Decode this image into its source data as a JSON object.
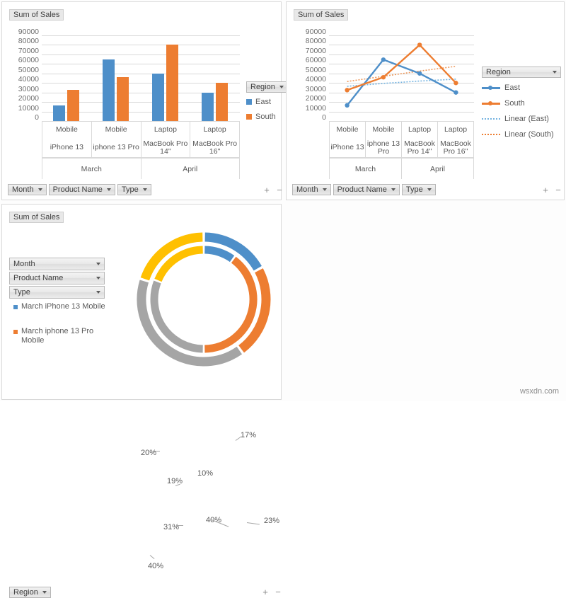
{
  "watermark": "wsxdn.com",
  "colors": {
    "east": "#4e8fc9",
    "south": "#ed7d31",
    "gray": "#a5a5a5",
    "yellow": "#ffc000",
    "gridline": "#d9d9d9"
  },
  "panels": {
    "bar": {
      "title": "Sum of Sales",
      "legend_header": "Region",
      "field_buttons": [
        "Month",
        "Product Name",
        "Type"
      ],
      "expand_label": "+",
      "collapse_label": "−"
    },
    "line": {
      "title": "Sum of Sales",
      "legend_header": "Region",
      "field_buttons": [
        "Month",
        "Product Name",
        "Type"
      ],
      "expand_label": "+",
      "collapse_label": "−"
    },
    "pie": {
      "title": "Sum of Sales",
      "slicers": [
        "Month",
        "Product Name",
        "Type"
      ],
      "legend": [
        "March iPhone 13 Mobile",
        "March iphone 13 Pro Mobile"
      ],
      "field_button": "Region",
      "expand_label": "+",
      "collapse_label": "−"
    }
  },
  "chart_data": [
    {
      "type": "bar",
      "title": "Sum of Sales",
      "categories": [
        "Mobile",
        "Mobile",
        "Laptop",
        "Laptop"
      ],
      "category_level2": [
        "iPhone 13",
        "iphone 13 Pro",
        "MacBook Pro 14\"",
        "MacBook Pro 16\""
      ],
      "category_level3": [
        "March",
        "April"
      ],
      "series": [
        {
          "name": "East",
          "values": [
            16500,
            64500,
            50000,
            30000
          ]
        },
        {
          "name": "South",
          "values": [
            32500,
            46000,
            80000,
            40000
          ]
        }
      ],
      "ylabel": "",
      "xlabel": "",
      "ylim": [
        0,
        90000
      ],
      "yticks": [
        90000,
        80000,
        70000,
        60000,
        50000,
        40000,
        30000,
        20000,
        10000,
        0
      ],
      "grid": true,
      "legend_position": "right",
      "legend_entries": [
        "East",
        "South"
      ]
    },
    {
      "type": "line",
      "title": "Sum of Sales",
      "categories": [
        "Mobile",
        "Mobile",
        "Laptop",
        "Laptop"
      ],
      "category_level2": [
        "iPhone 13",
        "iphone 13 Pro",
        "MacBook Pro 14\"",
        "MacBook Pro 16\""
      ],
      "category_level3": [
        "March",
        "April"
      ],
      "series": [
        {
          "name": "East",
          "values": [
            16500,
            64500,
            50000,
            30000
          ]
        },
        {
          "name": "South",
          "values": [
            32500,
            46000,
            80000,
            40000
          ]
        },
        {
          "name": "Linear (East)",
          "values": [
            36500,
            39500,
            42000,
            44000
          ]
        },
        {
          "name": "Linear (South)",
          "values": [
            41500,
            47000,
            52500,
            57500
          ]
        }
      ],
      "ylim": [
        0,
        90000
      ],
      "yticks": [
        90000,
        80000,
        70000,
        60000,
        50000,
        40000,
        30000,
        20000,
        10000,
        0
      ],
      "grid": true,
      "legend_position": "right",
      "legend_entries": [
        "East",
        "South",
        "Linear (East)",
        "Linear (South)"
      ]
    },
    {
      "type": "pie",
      "title": "Sum of Sales",
      "variant": "doughnut",
      "rings": [
        {
          "name": "outer",
          "labels": [
            "17%",
            "23%",
            "40%",
            "20%"
          ],
          "values": [
            17,
            23,
            40,
            20
          ],
          "colors": [
            "#4e8fc9",
            "#ed7d31",
            "#a5a5a5",
            "#ffc000"
          ]
        },
        {
          "name": "inner",
          "labels": [
            "10%",
            "40%",
            "31%",
            "19%"
          ],
          "values": [
            10,
            40,
            31,
            19
          ],
          "colors": [
            "#4e8fc9",
            "#ed7d31",
            "#a5a5a5",
            "#ffc000"
          ]
        }
      ],
      "legend_entries": [
        "March iPhone 13 Mobile",
        "March iphone 13 Pro Mobile"
      ],
      "legend_position": "left"
    }
  ]
}
